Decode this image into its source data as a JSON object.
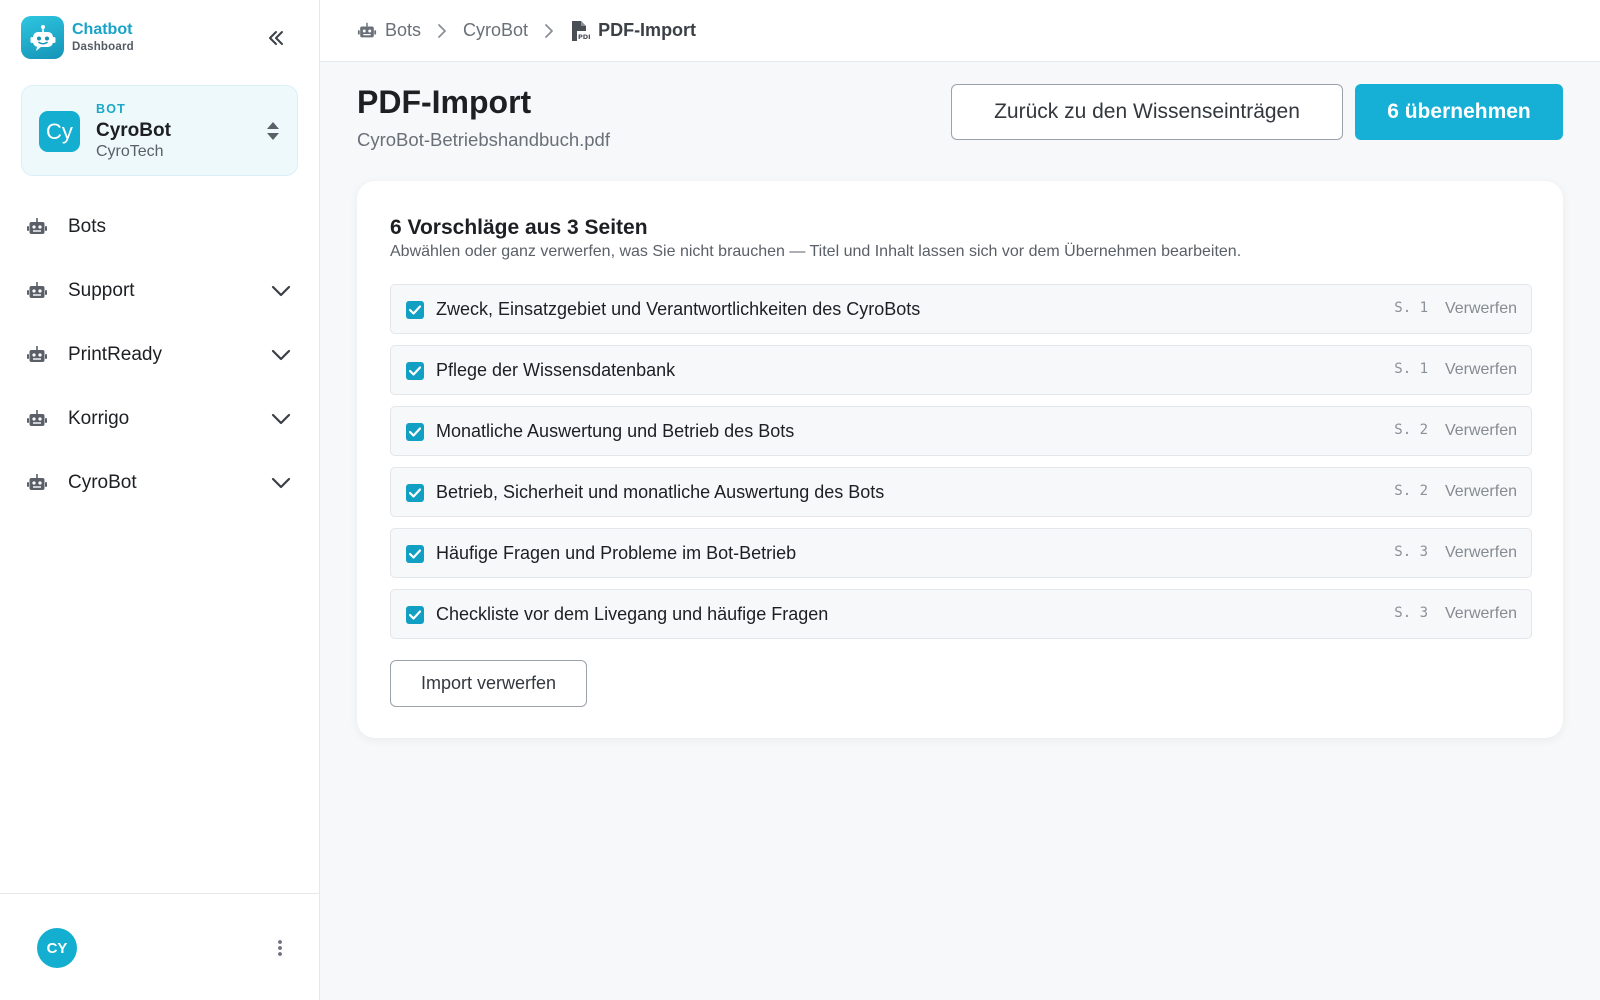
{
  "brand": {
    "title": "Chatbot",
    "subtitle": "Dashboard",
    "icon": "robot-logo-icon"
  },
  "sidebar": {
    "collapse_icon": "double-chevron-left-icon",
    "bot_card": {
      "eyebrow": "BOT",
      "avatar_initials": "Cy",
      "name": "CyroBot",
      "org": "CyroTech",
      "switch_icon": "sort-updown-icon"
    },
    "nav_items": [
      {
        "label": "Bots",
        "icon": "robot-icon",
        "expandable": false
      },
      {
        "label": "Support",
        "icon": "robot-icon",
        "expandable": true
      },
      {
        "label": "PrintReady",
        "icon": "robot-icon",
        "expandable": true
      },
      {
        "label": "Korrigo",
        "icon": "robot-icon",
        "expandable": true
      },
      {
        "label": "CyroBot",
        "icon": "robot-icon",
        "expandable": true
      }
    ],
    "user": {
      "initials": "CY",
      "menu_icon": "more-vertical-icon"
    }
  },
  "breadcrumb": [
    {
      "label": "Bots",
      "icon": "robot-icon"
    },
    {
      "label": "CyroBot"
    },
    {
      "label": "PDF-Import",
      "icon": "pdf-file-icon"
    }
  ],
  "header": {
    "title": "PDF-Import",
    "filename": "CyroBot-Betriebshandbuch.pdf",
    "back_button": "Zurück zu den Wissenseinträgen",
    "apply_button": "6 übernehmen"
  },
  "card": {
    "title": "6 Vorschläge aus 3 Seiten",
    "description": "Abwählen oder ganz verwerfen, was Sie nicht brauchen — Titel und Inhalt lassen sich vor dem Übernehmen bearbeiten.",
    "discard_all_button": "Import verwerfen",
    "discard_label": "Verwerfen",
    "suggestions": [
      {
        "title": "Zweck, Einsatzgebiet und Verantwortlichkeiten des CyroBots",
        "page": "S. 1",
        "checked": true
      },
      {
        "title": "Pflege der Wissensdatenbank",
        "page": "S. 1",
        "checked": true
      },
      {
        "title": "Monatliche Auswertung und Betrieb des Bots",
        "page": "S. 2",
        "checked": true
      },
      {
        "title": "Betrieb, Sicherheit und monatliche Auswertung des Bots",
        "page": "S. 2",
        "checked": true
      },
      {
        "title": "Häufige Fragen und Probleme im Bot-Betrieb",
        "page": "S. 3",
        "checked": true
      },
      {
        "title": "Checkliste vor dem Livegang und häufige Fragen",
        "page": "S. 3",
        "checked": true
      }
    ]
  },
  "colors": {
    "accent": "#16b0d6",
    "accent_dark": "#129fc4",
    "bot_card_bg": "#eef9fc",
    "page_bg": "#f6f8fa",
    "text": "#1d1f23",
    "muted_text": "#6a7078"
  }
}
